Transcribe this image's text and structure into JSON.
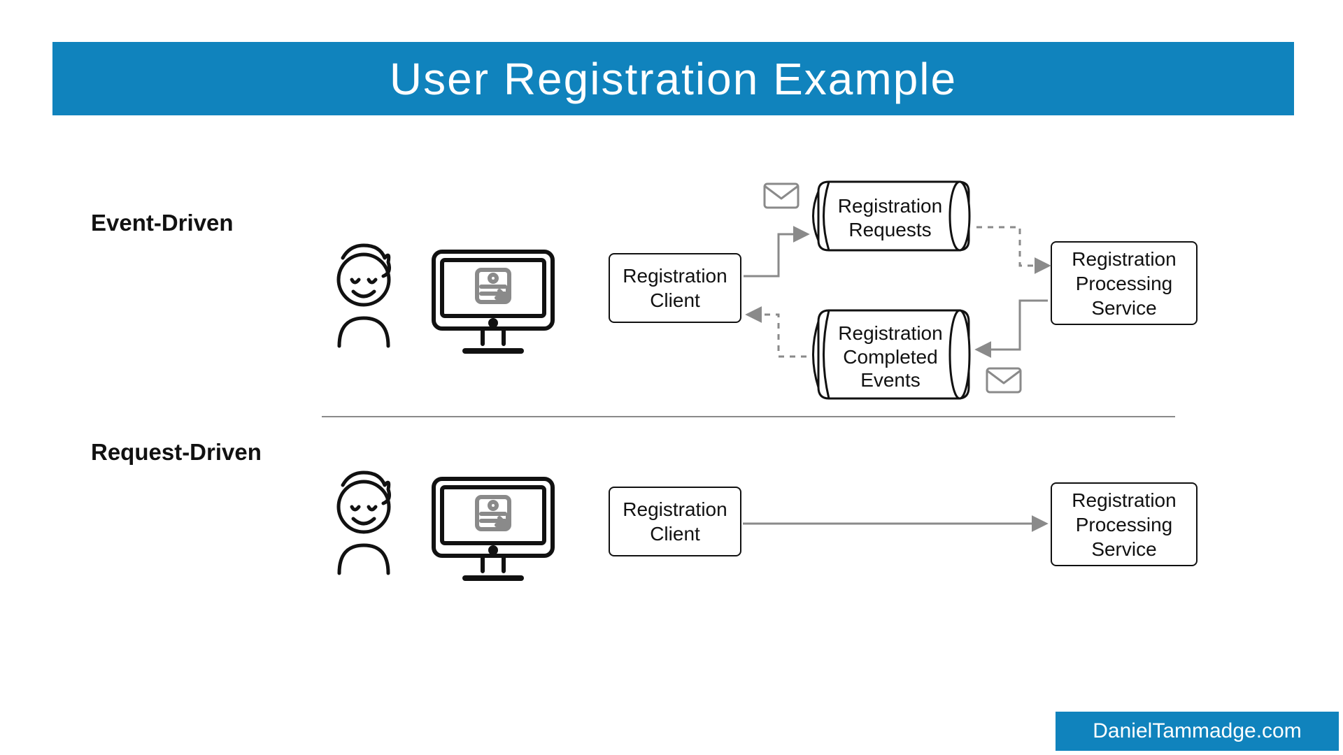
{
  "title": "User Registration Example",
  "sections": {
    "event": "Event-Driven",
    "request": "Request-Driven"
  },
  "boxes": {
    "regClient": "Registration\nClient",
    "regProcService": "Registration\nProcessing\nService"
  },
  "queues": {
    "requests": "Registration\nRequests",
    "completed": "Registration\nCompleted\nEvents"
  },
  "footer": "DanielTammadge.com",
  "icons": {
    "envelope": "envelope-icon",
    "user": "user-icon",
    "computer": "computer-icon"
  },
  "colors": {
    "brand": "#1083bd",
    "line": "#8a8a8a",
    "ink": "#111111"
  }
}
